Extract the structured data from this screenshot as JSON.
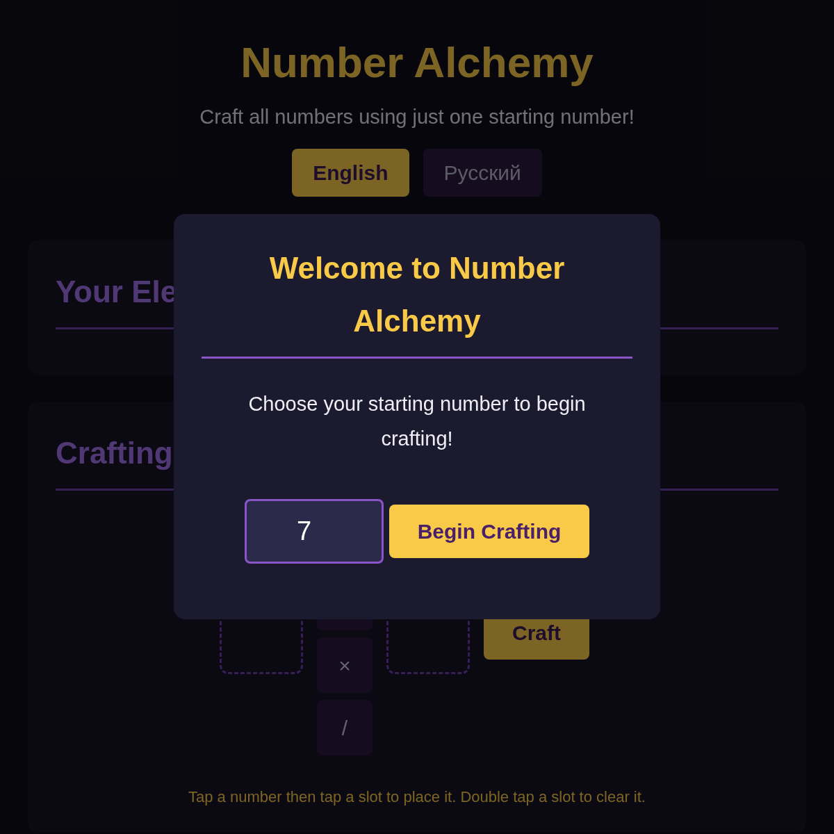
{
  "page": {
    "title": "Number Alchemy",
    "subtitle": "Craft all numbers using just one starting number!"
  },
  "languages": [
    {
      "label": "English",
      "selected": true
    },
    {
      "label": "Русский",
      "selected": false
    }
  ],
  "elements_panel": {
    "heading": "Your Ele"
  },
  "crafting_panel": {
    "heading": "Crafting",
    "operators": [
      {
        "kind": "covered"
      },
      {
        "kind": "symbol",
        "symbol": "×"
      },
      {
        "kind": "symbol",
        "symbol": "/"
      }
    ],
    "craft_button": "Craft",
    "hint": "Tap a number then tap a slot to place it. Double tap a slot to clear it."
  },
  "dialog": {
    "title": "Welcome to Number Alchemy",
    "message": "Choose your starting number to begin crafting!",
    "input_value": "7",
    "button": "Begin Crafting"
  }
}
